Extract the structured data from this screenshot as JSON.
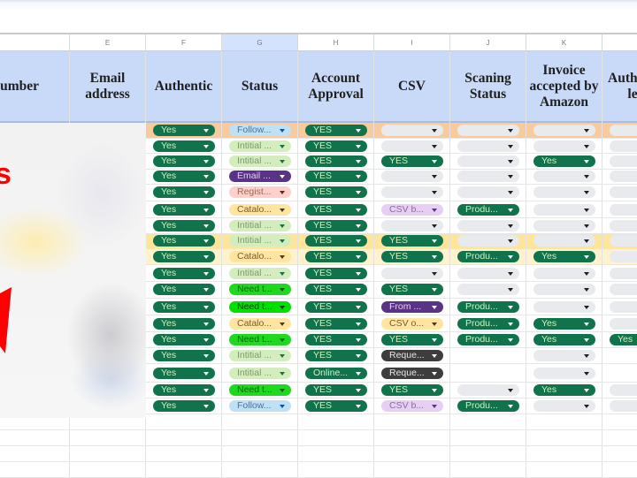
{
  "sheet": {
    "column_letters": [
      "",
      "E",
      "F",
      "G",
      "H",
      "I",
      "J",
      "K",
      ""
    ],
    "selected_column": "G",
    "headers": [
      "umber",
      "Email address",
      "Authentic",
      "Status",
      "Account Approval",
      "CSV",
      "Scaning Status",
      "Invoice accepted by Amazon",
      "Auth le"
    ],
    "annotation_text": "s",
    "rows": [
      {
        "highlight": "orange",
        "authentic": "Yes",
        "status": {
          "text": "Follow...",
          "style": "blue"
        },
        "approval": {
          "text": "YES",
          "style": "green"
        },
        "csv": {
          "text": "",
          "style": "gray"
        },
        "scan": {
          "text": "",
          "style": "gray"
        },
        "invoice": {
          "text": "",
          "style": "gray"
        },
        "auth": {
          "text": "",
          "style": "gray"
        }
      },
      {
        "highlight": "",
        "authentic": "Yes",
        "status": {
          "text": "Intitial ...",
          "style": "lgreen"
        },
        "approval": {
          "text": "YES",
          "style": "green"
        },
        "csv": {
          "text": "",
          "style": "gray"
        },
        "scan": {
          "text": "",
          "style": "gray"
        },
        "invoice": {
          "text": "",
          "style": "gray"
        },
        "auth": {
          "text": "",
          "style": "gray"
        }
      },
      {
        "highlight": "",
        "authentic": "Yes",
        "status": {
          "text": "Intitial ...",
          "style": "lgreen"
        },
        "approval": {
          "text": "YES",
          "style": "green"
        },
        "csv": {
          "text": "YES",
          "style": "green"
        },
        "scan": {
          "text": "",
          "style": "gray"
        },
        "invoice": {
          "text": "Yes",
          "style": "green"
        },
        "auth": {
          "text": "",
          "style": "gray"
        }
      },
      {
        "highlight": "",
        "authentic": "Yes",
        "status": {
          "text": "Email ...",
          "style": "purple"
        },
        "approval": {
          "text": "YES",
          "style": "green"
        },
        "csv": {
          "text": "",
          "style": "gray"
        },
        "scan": {
          "text": "",
          "style": "gray"
        },
        "invoice": {
          "text": "",
          "style": "gray"
        },
        "auth": {
          "text": "",
          "style": "gray"
        }
      },
      {
        "highlight": "",
        "authentic": "Yes",
        "status": {
          "text": "Regist...",
          "style": "peach"
        },
        "approval": {
          "text": "YES",
          "style": "green"
        },
        "csv": {
          "text": "",
          "style": "gray"
        },
        "scan": {
          "text": "",
          "style": "gray"
        },
        "invoice": {
          "text": "",
          "style": "gray"
        },
        "auth": {
          "text": "",
          "style": "gray"
        }
      },
      {
        "highlight": "",
        "authentic": "Yes",
        "status": {
          "text": "Catalo...",
          "style": "orange"
        },
        "approval": {
          "text": "YES",
          "style": "green"
        },
        "csv": {
          "text": "CSV b...",
          "style": "lpurple"
        },
        "scan": {
          "text": "Produ...",
          "style": "green"
        },
        "invoice": {
          "text": "",
          "style": "gray"
        },
        "auth": {
          "text": "",
          "style": "gray"
        }
      },
      {
        "highlight": "",
        "authentic": "Yes",
        "status": {
          "text": "Intitial ...",
          "style": "lgreen"
        },
        "approval": {
          "text": "YES",
          "style": "green"
        },
        "csv": {
          "text": "",
          "style": "gray"
        },
        "scan": {
          "text": "",
          "style": "gray"
        },
        "invoice": {
          "text": "",
          "style": "gray"
        },
        "auth": {
          "text": "",
          "style": "gray"
        }
      },
      {
        "highlight": "yellow",
        "authentic": "Yes",
        "status": {
          "text": "Intitial ...",
          "style": "lgreen"
        },
        "approval": {
          "text": "YES",
          "style": "green"
        },
        "csv": {
          "text": "YES",
          "style": "green"
        },
        "scan": {
          "text": "",
          "style": "gray"
        },
        "invoice": {
          "text": "",
          "style": "gray"
        },
        "auth": {
          "text": "",
          "style": "gray"
        }
      },
      {
        "highlight": "lyellow",
        "authentic": "Yes",
        "status": {
          "text": "Catalo...",
          "style": "orange"
        },
        "approval": {
          "text": "YES",
          "style": "green"
        },
        "csv": {
          "text": "YES",
          "style": "green"
        },
        "scan": {
          "text": "Produ...",
          "style": "green"
        },
        "invoice": {
          "text": "Yes",
          "style": "green"
        },
        "auth": {
          "text": "",
          "style": "gray"
        }
      },
      {
        "highlight": "",
        "authentic": "Yes",
        "status": {
          "text": "Intitial ...",
          "style": "lgreen"
        },
        "approval": {
          "text": "YES",
          "style": "green"
        },
        "csv": {
          "text": "",
          "style": "gray"
        },
        "scan": {
          "text": "",
          "style": "gray"
        },
        "invoice": {
          "text": "",
          "style": "gray"
        },
        "auth": {
          "text": "",
          "style": "gray"
        }
      },
      {
        "highlight": "",
        "authentic": "Yes",
        "status": {
          "text": "Need t...",
          "style": "bright"
        },
        "approval": {
          "text": "YES",
          "style": "green"
        },
        "csv": {
          "text": "YES",
          "style": "green"
        },
        "scan": {
          "text": "",
          "style": "gray"
        },
        "invoice": {
          "text": "",
          "style": "gray"
        },
        "auth": {
          "text": "",
          "style": "gray"
        }
      },
      {
        "highlight": "",
        "authentic": "Yes",
        "status": {
          "text": "Need t...",
          "style": "bright-dark"
        },
        "approval": {
          "text": "YES",
          "style": "green"
        },
        "csv": {
          "text": "From ...",
          "style": "purple"
        },
        "scan": {
          "text": "Produ...",
          "style": "green"
        },
        "invoice": {
          "text": "",
          "style": "gray"
        },
        "auth": {
          "text": "",
          "style": "gray"
        }
      },
      {
        "highlight": "",
        "authentic": "Yes",
        "status": {
          "text": "Catalo...",
          "style": "orange"
        },
        "approval": {
          "text": "YES",
          "style": "green"
        },
        "csv": {
          "text": "CSV o...",
          "style": "orange"
        },
        "scan": {
          "text": "Produ...",
          "style": "green"
        },
        "invoice": {
          "text": "Yes",
          "style": "green"
        },
        "auth": {
          "text": "",
          "style": "gray"
        }
      },
      {
        "highlight": "",
        "authentic": "Yes",
        "status": {
          "text": "Need t...",
          "style": "bright"
        },
        "approval": {
          "text": "YES",
          "style": "green"
        },
        "csv": {
          "text": "YES",
          "style": "green"
        },
        "scan": {
          "text": "Produ...",
          "style": "green"
        },
        "invoice": {
          "text": "Yes",
          "style": "green"
        },
        "auth": {
          "text": "Yes",
          "style": "green"
        }
      },
      {
        "highlight": "",
        "authentic": "Yes",
        "status": {
          "text": "Intitial ...",
          "style": "lgreen"
        },
        "approval": {
          "text": "YES",
          "style": "green"
        },
        "csv": {
          "text": "Reque...",
          "style": "dark"
        },
        "scan": null,
        "invoice": {
          "text": "",
          "style": "gray"
        },
        "auth": null
      },
      {
        "highlight": "",
        "authentic": "Yes",
        "status": {
          "text": "Intitial ...",
          "style": "lgreen"
        },
        "approval": {
          "text": "Online...",
          "style": "green"
        },
        "csv": {
          "text": "Reque...",
          "style": "dark"
        },
        "scan": null,
        "invoice": {
          "text": "",
          "style": "gray"
        },
        "auth": null
      },
      {
        "highlight": "",
        "authentic": "Yes",
        "status": {
          "text": "Need t...",
          "style": "bright"
        },
        "approval": {
          "text": "YES",
          "style": "green"
        },
        "csv": {
          "text": "YES",
          "style": "green"
        },
        "scan": {
          "text": "",
          "style": "gray"
        },
        "invoice": {
          "text": "Yes",
          "style": "green"
        },
        "auth": {
          "text": "",
          "style": "gray"
        }
      },
      {
        "highlight": "",
        "authentic": "Yes",
        "status": {
          "text": "Follow...",
          "style": "blue"
        },
        "approval": {
          "text": "YES",
          "style": "green"
        },
        "csv": {
          "text": "CSV b...",
          "style": "lpurple"
        },
        "scan": {
          "text": "Produ...",
          "style": "green"
        },
        "invoice": {
          "text": "",
          "style": "gray"
        },
        "auth": {
          "text": "",
          "style": "gray"
        }
      }
    ]
  },
  "colors": {
    "header_bg": "#c9daf8",
    "chip_green": "#11734b",
    "highlight_orange": "#f9cb9c",
    "highlight_yellow": "#ffe599",
    "annotation_red": "#ff0000"
  }
}
